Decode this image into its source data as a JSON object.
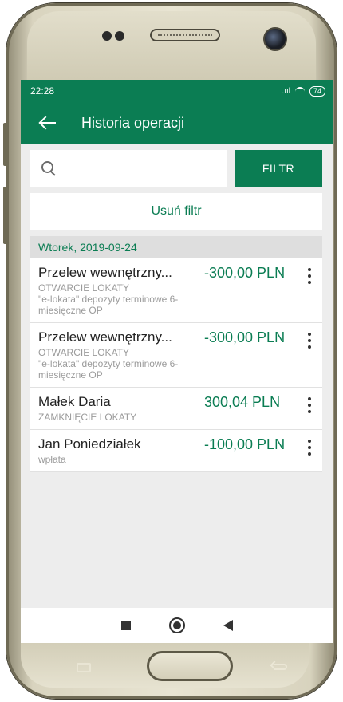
{
  "status": {
    "time": "22:28",
    "signal": ".ull",
    "wifi": "wifi",
    "battery": "74"
  },
  "header": {
    "title": "Historia operacji",
    "back_icon": "arrow-left-icon"
  },
  "search": {
    "placeholder": "",
    "value": ""
  },
  "filter_button": "FILTR",
  "clear_filter": "Usuń filtr",
  "list": {
    "date": "Wtorek, 2019-09-24",
    "items": [
      {
        "title": "Przelew wewnętrzny...",
        "subtitle": "OTWARCIE LOKATY\n\"e-lokata\" depozyty terminowe 6-miesięczne OP",
        "amount": "-300,00 PLN"
      },
      {
        "title": "Przelew wewnętrzny...",
        "subtitle": "OTWARCIE LOKATY\n\"e-lokata\" depozyty terminowe 6-miesięczne OP",
        "amount": "-300,00 PLN"
      },
      {
        "title": "Małek Daria",
        "subtitle": "ZAMKNIĘCIE LOKATY",
        "amount": "300,04 PLN"
      },
      {
        "title": "Jan Poniedziałek",
        "subtitle": "wpłata",
        "amount": "-100,00 PLN"
      }
    ]
  },
  "colors": {
    "brand_green": "#0b7d53",
    "list_bg": "#ededed",
    "subtitle": "#9b9b9b"
  }
}
